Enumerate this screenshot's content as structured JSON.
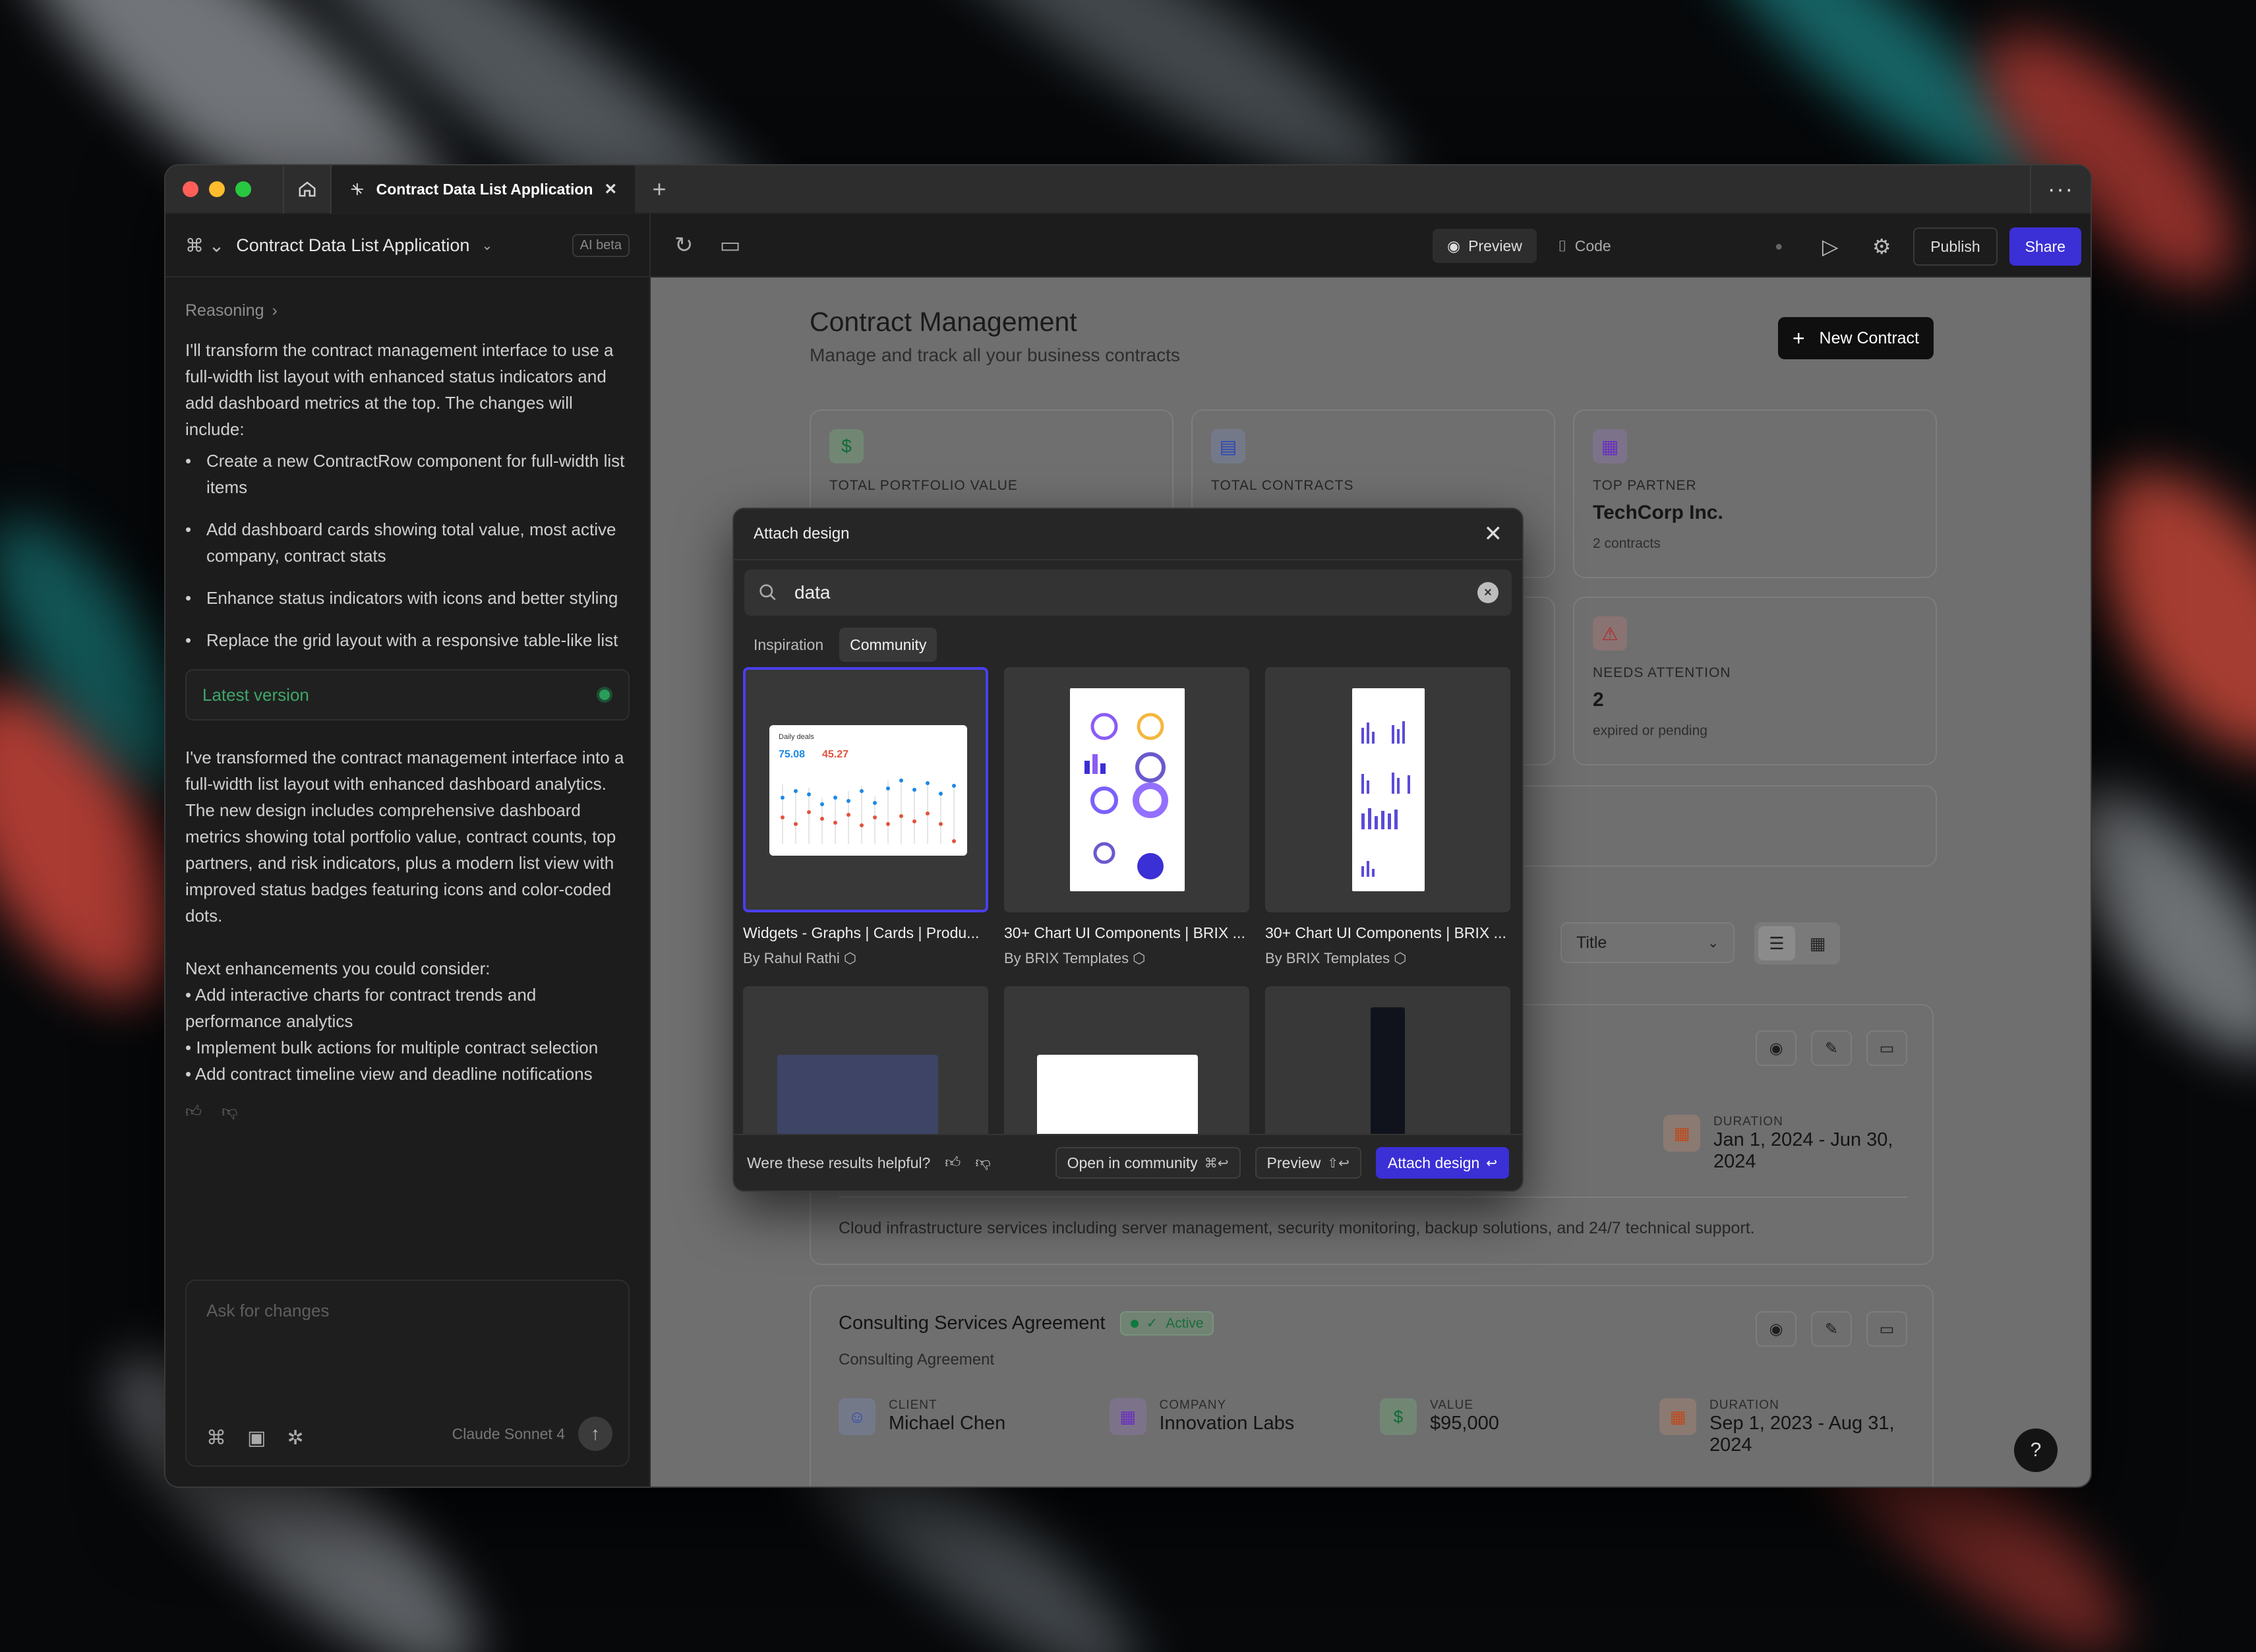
{
  "window": {
    "tab_title": "Contract Data List Application",
    "new_tab_label": "+",
    "more_label": "···"
  },
  "left_panel": {
    "project_name": "Contract Data List Application",
    "beta_badge": "AI beta",
    "reasoning_label": "Reasoning",
    "intro": "I'll transform the contract management interface to use a full-width list layout with enhanced status indicators and add dashboard metrics at the top. The changes will include:",
    "changes": [
      "Create a new ContractRow component for full-width list items",
      "Add dashboard cards showing total value, most active company, contract stats",
      "Enhance status indicators with icons and better styling",
      "Replace the grid layout with a responsive table-like list"
    ],
    "latest_version_label": "Latest version",
    "summary": "I've transformed the contract management interface into a full-width list layout with enhanced dashboard analytics. The new design includes comprehensive dashboard metrics showing total portfolio value, contract counts, top partners, and risk indicators, plus a modern list view with improved status badges featuring icons and color-coded dots.",
    "next_title": "Next enhancements you could consider:",
    "next_items": [
      "• Add interactive charts for contract trends and performance analytics",
      "• Implement bulk actions for multiple contract selection",
      "• Add contract timeline view and deadline notifications"
    ],
    "ask_placeholder": "Ask for changes",
    "model_label": "Claude Sonnet 4"
  },
  "toolbar": {
    "preview_label": "Preview",
    "code_label": "Code",
    "publish_label": "Publish",
    "share_label": "Share"
  },
  "page": {
    "title": "Contract Management",
    "subtitle": "Manage and track all your business contracts",
    "new_contract_label": "New Contract",
    "stats": {
      "portfolio_label": "TOTAL PORTFOLIO VALUE",
      "contracts_label": "TOTAL CONTRACTS",
      "partner_label": "TOP PARTNER",
      "partner_value": "TechCorp Inc.",
      "partner_sub": "2 contracts",
      "attention_label": "NEEDS ATTENTION",
      "attention_value": "2",
      "attention_sub": "expired or pending"
    },
    "sort_select": "Title",
    "row1": {
      "duration_label": "DURATION",
      "duration_value": "Jan 1, 2024 - Jun 30, 2024",
      "description": "Cloud infrastructure services including server management, security monitoring, backup solutions, and 24/7 technical support."
    },
    "row2": {
      "title": "Consulting Services Agreement",
      "status": "Active",
      "type": "Consulting Agreement",
      "client_label": "CLIENT",
      "client_value": "Michael Chen",
      "company_label": "COMPANY",
      "company_value": "Innovation Labs",
      "value_label": "VALUE",
      "value_value": "$95,000",
      "duration_label": "DURATION",
      "duration_value": "Sep 1, 2023 - Aug 31, 2024"
    },
    "help_label": "?"
  },
  "modal": {
    "title": "Attach design",
    "search_value": "data",
    "tabs": [
      "Inspiration",
      "Community"
    ],
    "results": [
      {
        "name": "Widgets - Graphs | Cards | Produ...",
        "author": "By Rahul Rathi",
        "thumb_a": "Daily deals",
        "thumb_b": "75.08",
        "thumb_c": "45.27"
      },
      {
        "name": "30+ Chart UI Components | BRIX ...",
        "author": "By BRIX Templates"
      },
      {
        "name": "30+ Chart UI Components | BRIX ...",
        "author": "By BRIX Templates"
      }
    ],
    "helpful_question": "Were these results helpful?",
    "open_community_label": "Open in community",
    "open_community_kbd": "⌘↩",
    "preview_label": "Preview",
    "preview_kbd": "⇧↩",
    "attach_label": "Attach design",
    "attach_kbd": "↩"
  },
  "colors": {
    "accent": "#3b2fd6",
    "selected_outline": "#4a3ff0",
    "active_green": "#2a9d5b"
  }
}
